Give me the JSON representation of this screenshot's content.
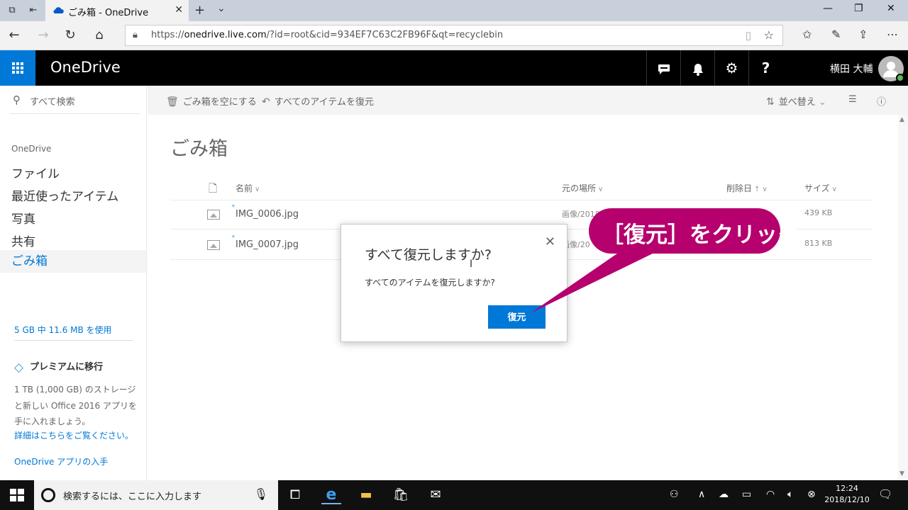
{
  "browser": {
    "tab_title": "ごみ箱 - OneDrive",
    "url_prefix": "https://",
    "url_host": "onedrive.live.com",
    "url_rest": "/?id=root&cid=934EF7C63C2FB96F&qt=recyclebin"
  },
  "header": {
    "brand": "OneDrive",
    "user_name": "横田 大輔"
  },
  "sidebar": {
    "search_placeholder": "すべて検索",
    "section": "OneDrive",
    "items": [
      {
        "label": "ファイル"
      },
      {
        "label": "最近使ったアイテム"
      },
      {
        "label": "写真"
      },
      {
        "label": "共有"
      },
      {
        "label": "ごみ箱"
      }
    ],
    "quota": "5 GB 中 11.6 MB を使用",
    "premium_title": "プレミアムに移行",
    "premium_desc": "1 TB (1,000 GB) のストレージと新しい Office 2016 アプリを手に入れましょう。",
    "premium_link": "詳細はこちらをご覧ください。",
    "app_link": "OneDrive アプリの入手"
  },
  "commands": {
    "empty_bin": "ごみ箱を空にする",
    "restore_all": "すべてのアイテムを復元",
    "sort": "並べ替え"
  },
  "main": {
    "title": "ごみ箱",
    "columns": {
      "name": "名前",
      "location": "元の場所",
      "deleted": "削除日",
      "size": "サイズ"
    },
    "rows": [
      {
        "name": "IMG_0006.jpg",
        "location": "画像/2018",
        "size": "439 KB"
      },
      {
        "name": "IMG_0007.jpg",
        "location": "画像/20",
        "size": "813 KB"
      }
    ]
  },
  "dialog": {
    "title": "すべて復元しますか?",
    "body": "すべてのアイテムを復元しますか?",
    "button": "復元"
  },
  "callout": {
    "text": "［復元］をクリック",
    "color": "#b5006e"
  },
  "taskbar": {
    "search_placeholder": "検索するには、ここに入力します",
    "time": "12:24",
    "date": "2018/12/10"
  },
  "colors": {
    "accent": "#0078d7",
    "header_bg": "#000000"
  }
}
